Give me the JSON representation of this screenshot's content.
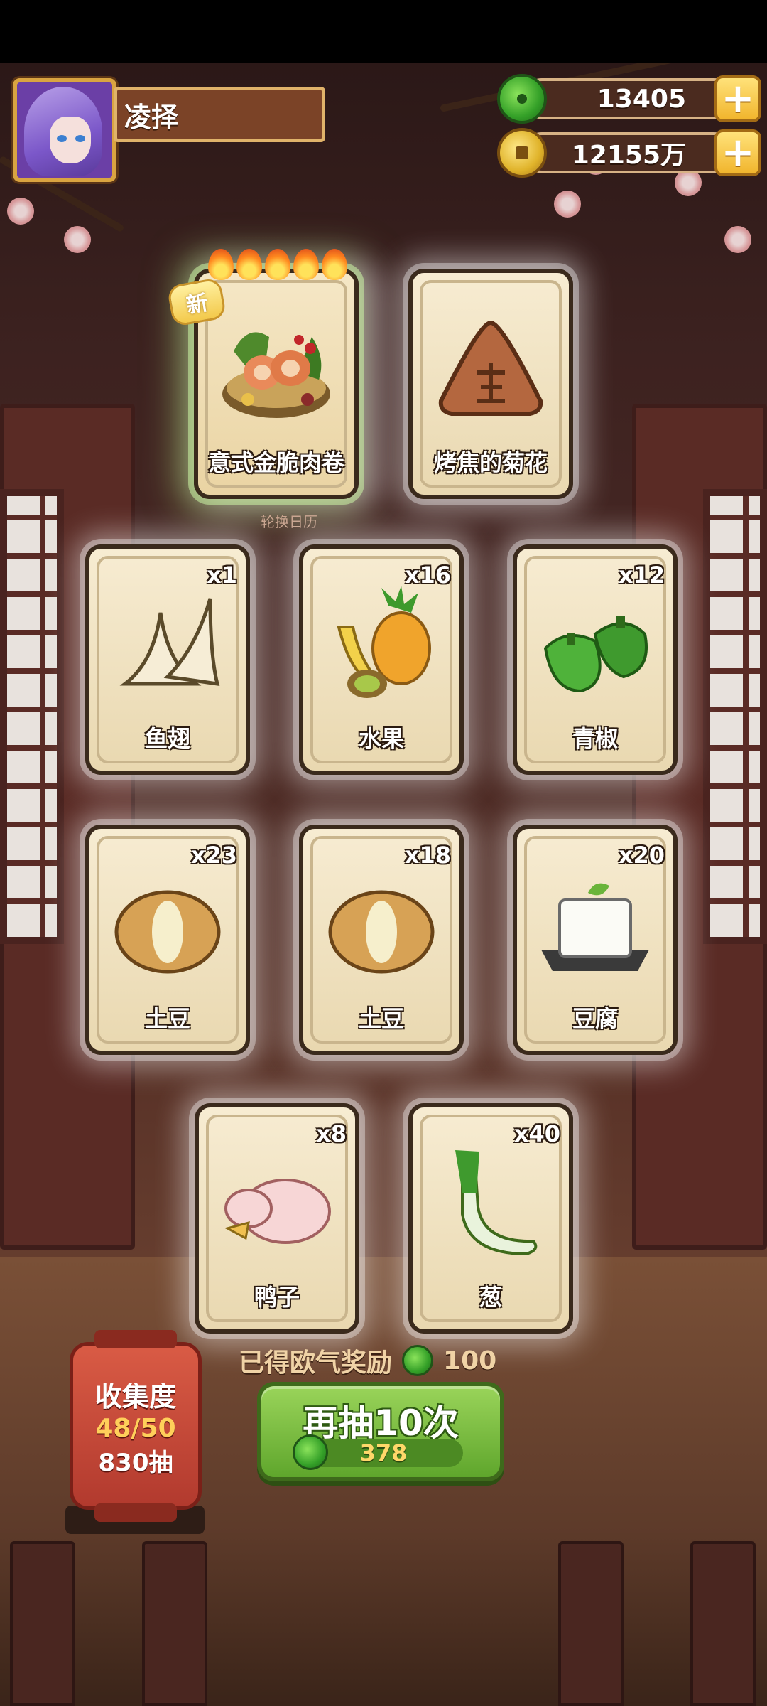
{
  "player": {
    "name": "凌择"
  },
  "currency": {
    "jade": {
      "value": "13405",
      "icon": "jade-coin-icon"
    },
    "gold": {
      "value": "12155万",
      "icon": "gold-coin-icon"
    },
    "add_symbol": "+"
  },
  "featured": {
    "new_badge": "新",
    "stars": 5,
    "calendar_caption": "轮换日历",
    "cards": [
      {
        "name": "意式金脆肉卷",
        "icon": "meat-roll-dish-icon"
      },
      {
        "name": "烤焦的菊花",
        "icon": "burnt-dish-icon"
      }
    ]
  },
  "cards": [
    {
      "name": "鱼翅",
      "count": "x1",
      "icon": "shark-fin-icon"
    },
    {
      "name": "水果",
      "count": "x16",
      "icon": "fruit-icon"
    },
    {
      "name": "青椒",
      "count": "x12",
      "icon": "green-pepper-icon"
    },
    {
      "name": "土豆",
      "count": "x23",
      "icon": "potato-icon"
    },
    {
      "name": "土豆",
      "count": "x18",
      "icon": "potato-icon"
    },
    {
      "name": "豆腐",
      "count": "x20",
      "icon": "tofu-icon"
    },
    {
      "name": "鸭子",
      "count": "x8",
      "icon": "duck-icon"
    },
    {
      "name": "葱",
      "count": "x40",
      "icon": "scallion-icon"
    }
  ],
  "collection": {
    "title": "收集度",
    "progress": "48/50",
    "draws": "830抽"
  },
  "lucky_reward": {
    "label": "已得欧气奖励",
    "value": "100"
  },
  "redraw": {
    "label": "再抽10次",
    "cost": "378"
  }
}
